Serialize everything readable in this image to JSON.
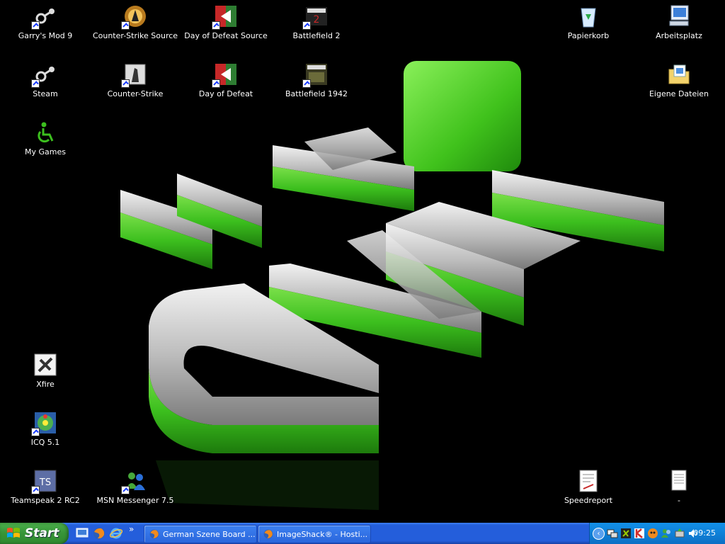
{
  "desktop": {
    "icons": [
      {
        "label": "Garry's Mod 9",
        "icon": "steam-icon"
      },
      {
        "label": "Counter-Strike Source",
        "icon": "cs-source-icon"
      },
      {
        "label": "Day of Defeat Source",
        "icon": "dod-source-icon"
      },
      {
        "label": "Battlefield 2",
        "icon": "battlefield2-icon"
      },
      {
        "label": "Papierkorb",
        "icon": "recycle-bin-icon"
      },
      {
        "label": "Arbeitsplatz",
        "icon": "my-computer-icon"
      },
      {
        "label": "Steam",
        "icon": "steam-icon"
      },
      {
        "label": "Counter-Strike",
        "icon": "counter-strike-icon"
      },
      {
        "label": "Day of Defeat",
        "icon": "dod-icon"
      },
      {
        "label": "Battlefield 1942",
        "icon": "battlefield1942-icon"
      },
      {
        "label": "Eigene Dateien",
        "icon": "my-documents-icon"
      },
      {
        "label": "My Games",
        "icon": "my-games-icon"
      },
      {
        "label": "Xfire",
        "icon": "xfire-icon"
      },
      {
        "label": "ICQ 5.1",
        "icon": "icq-icon"
      },
      {
        "label": "Teamspeak 2 RC2",
        "icon": "teamspeak-icon"
      },
      {
        "label": "MSN Messenger 7.5",
        "icon": "msn-icon"
      },
      {
        "label": "Speedreport",
        "icon": "speedreport-icon"
      },
      {
        "label": "-",
        "icon": "text-file-icon"
      }
    ],
    "wallpaper": {
      "letters": "CUBE",
      "accent": "#3cbf1e"
    }
  },
  "taskbar": {
    "start_label": "Start",
    "quicklaunch": [
      "show-desktop-icon",
      "firefox-icon",
      "internet-explorer-icon"
    ],
    "quicklaunch_more": "»",
    "tasks": [
      {
        "label": "German Szene Board ...",
        "icon": "firefox-icon"
      },
      {
        "label": "ImageShack® - Hosti...",
        "icon": "firefox-icon"
      }
    ],
    "tray": {
      "arrow": "‹",
      "icons": [
        "network-icon",
        "xfire-tray-icon",
        "k-tray-icon",
        "graphics-tray-icon",
        "msn-tray-icon",
        "safely-remove-icon",
        "volume-icon"
      ]
    },
    "clock": "09:25"
  },
  "colors": {
    "taskbar": "#245edb",
    "start": "#379437",
    "tray": "#0f81d8"
  }
}
